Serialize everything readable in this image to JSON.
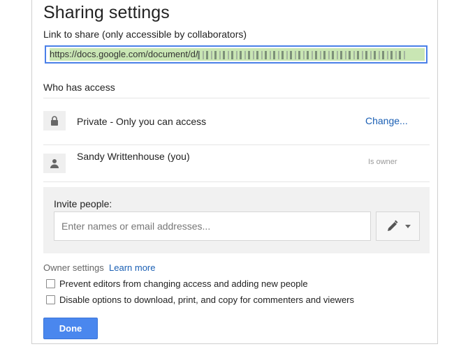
{
  "dialog": {
    "title": "Sharing settings"
  },
  "link": {
    "label": "Link to share (only accessible by collaborators)",
    "url_prefix": "https://docs.google.com/document/d/"
  },
  "access": {
    "heading": "Who has access",
    "rows": [
      {
        "icon": "lock-icon",
        "text": "Private - Only you can access",
        "action": "Change..."
      },
      {
        "icon": "person-icon",
        "text": "Sandy Writtenhouse (you)",
        "role": "Is owner"
      }
    ]
  },
  "invite": {
    "label": "Invite people:",
    "placeholder": "Enter names or email addresses...",
    "permission_icon": "pencil-icon"
  },
  "owner_settings": {
    "label": "Owner settings",
    "learn_more": "Learn more",
    "options": [
      {
        "label": "Prevent editors from changing access and adding new people",
        "checked": false
      },
      {
        "label": "Disable options to download, print, and copy for commenters and viewers",
        "checked": false
      }
    ]
  },
  "footer": {
    "done_label": "Done"
  },
  "colors": {
    "accent": "#4a87ee",
    "link": "#1a5fb4",
    "url_highlight": "#c9e6b4"
  }
}
